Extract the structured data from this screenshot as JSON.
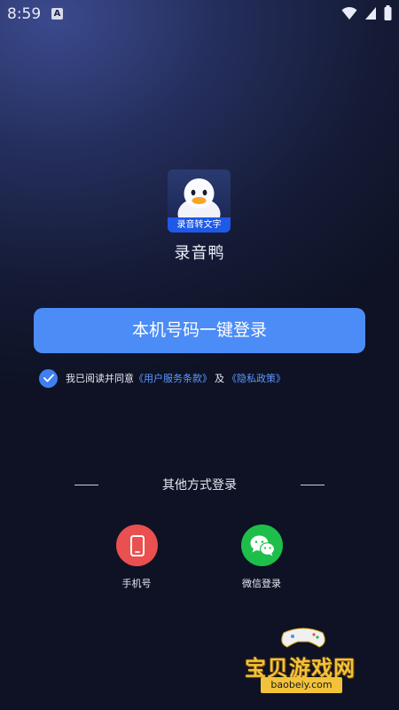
{
  "status_bar": {
    "time": "8:59",
    "notification_badge": "A"
  },
  "app": {
    "logo_tag": "录音转文字",
    "name": "录音鸭"
  },
  "login": {
    "onekey_label": "本机号码一键登录",
    "agreement": {
      "prefix": "我已阅读并同意",
      "terms_link": "《用户服务条款》",
      "separator": "及",
      "privacy_link": "《隐私政策》",
      "checked": true
    }
  },
  "other_methods": {
    "title": "其他方式登录",
    "options": [
      {
        "label": "手机号",
        "icon": "phone-icon",
        "color": "#e9504f"
      },
      {
        "label": "微信登录",
        "icon": "wechat-icon",
        "color": "#1dbf4a"
      }
    ]
  },
  "watermark": {
    "text": "宝贝游戏网",
    "url": "baobeiy.com"
  },
  "colors": {
    "accent": "#4b8cf6",
    "link": "#5f97ff"
  }
}
